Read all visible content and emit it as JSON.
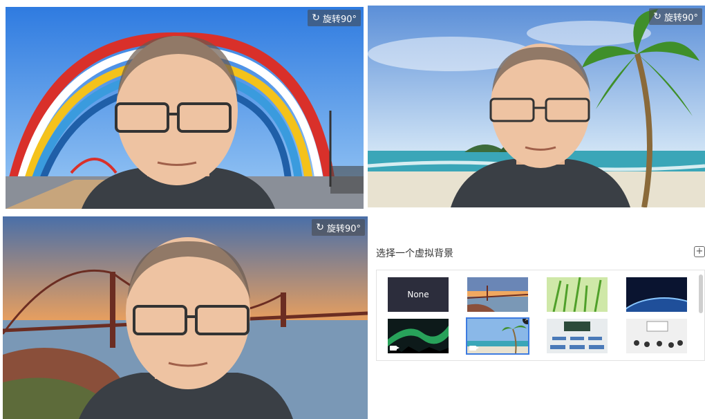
{
  "panels": [
    {
      "rotate_label": "旋转90°",
      "background": "rainbow-arch-bridge"
    },
    {
      "rotate_label": "旋转90°",
      "background": "tropical-beach-palm"
    },
    {
      "rotate_label": "旋转90°",
      "background": "golden-gate-sunset"
    }
  ],
  "virtual_background": {
    "title": "选择一个虚拟背景",
    "add_icon": "plus-square-icon",
    "thumbnails": [
      {
        "label": "None",
        "kind": "none"
      },
      {
        "name": "golden-gate",
        "kind": "image"
      },
      {
        "name": "green-grass",
        "kind": "image"
      },
      {
        "name": "earth-space",
        "kind": "image"
      },
      {
        "name": "aurora",
        "kind": "video"
      },
      {
        "name": "beach",
        "kind": "video",
        "selected": true,
        "close": "×"
      },
      {
        "name": "classroom-empty",
        "kind": "image"
      },
      {
        "name": "classroom-students",
        "kind": "image"
      }
    ]
  },
  "colors": {
    "selected_outline": "#3d7be0",
    "none_tile": "#2c2d3c"
  }
}
